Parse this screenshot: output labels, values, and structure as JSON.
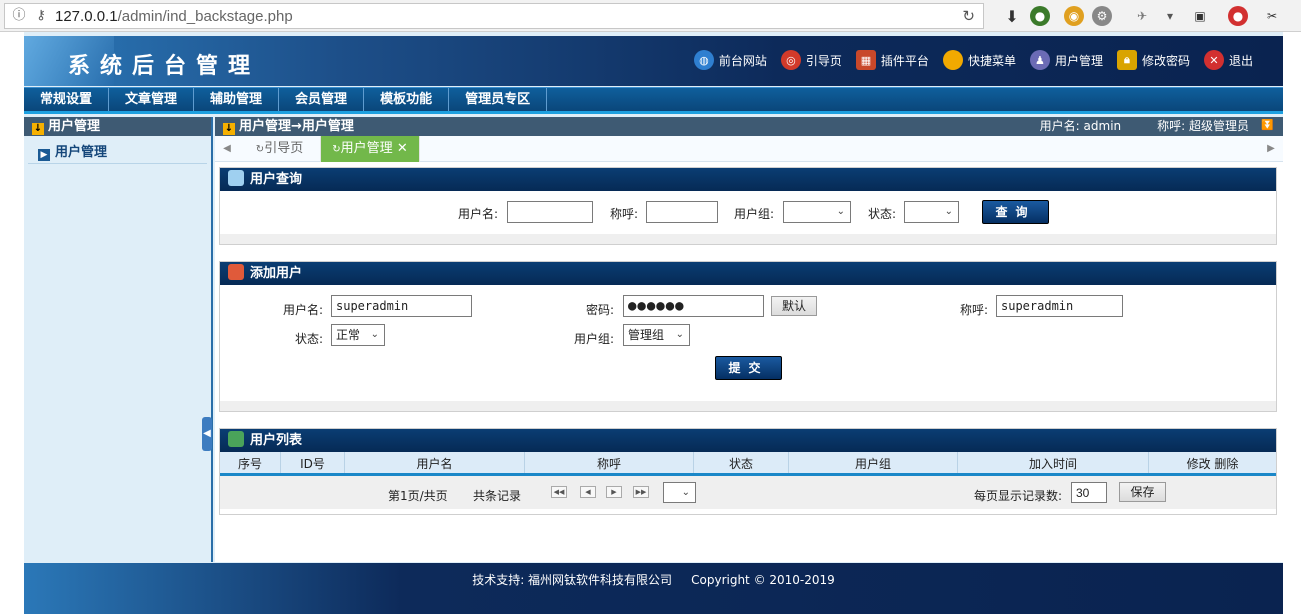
{
  "browser": {
    "url_host": "127.0.0.1",
    "url_path": "/admin/ind_backstage.php"
  },
  "app": {
    "title": "系统后台管理",
    "top_links": [
      {
        "label": "前台网站",
        "icon": "globe-icon",
        "color": "#2f7fd0"
      },
      {
        "label": "引导页",
        "icon": "lifebuoy-icon",
        "color": "#d23a2a"
      },
      {
        "label": "插件平台",
        "icon": "shop-icon",
        "color": "#c8482a"
      },
      {
        "label": "快捷菜单",
        "icon": "orb-icon",
        "color": "#f2a900"
      },
      {
        "label": "用户管理",
        "icon": "user-icon",
        "color": "#6b6bb5"
      },
      {
        "label": "修改密码",
        "icon": "lock-icon",
        "color": "#d9a400"
      },
      {
        "label": "退出",
        "icon": "close-icon",
        "color": "#d23030"
      }
    ],
    "nav": [
      "常规设置",
      "文章管理",
      "辅助管理",
      "会员管理",
      "模板功能",
      "管理员专区"
    ]
  },
  "sidebar": {
    "header": "用户管理",
    "items": [
      {
        "label": "用户管理"
      }
    ]
  },
  "content": {
    "breadcrumb": "用户管理→用户管理",
    "username_info": "用户名: admin",
    "title_info": "称呼: 超级管理员",
    "tabs": [
      {
        "label": "引导页",
        "active": false
      },
      {
        "label": "用户管理",
        "active": true
      }
    ]
  },
  "query_panel": {
    "title": "用户查询",
    "username_label": "用户名:",
    "nickname_label": "称呼:",
    "group_label": "用户组:",
    "status_label": "状态:",
    "submit_label": "查询"
  },
  "add_panel": {
    "title": "添加用户",
    "username_label": "用户名:",
    "username_value": "superadmin",
    "password_label": "密码:",
    "password_value": "●●●●●●",
    "default_label": "默认",
    "nickname_label": "称呼:",
    "nickname_value": "superadmin",
    "status_label": "状态:",
    "status_value": "正常",
    "group_label": "用户组:",
    "group_value": "管理组",
    "submit_label": "提交"
  },
  "list_panel": {
    "title": "用户列表",
    "columns": [
      "序号",
      "ID号",
      "用户名",
      "称呼",
      "状态",
      "用户组",
      "加入时间",
      "修改 删除"
    ],
    "pager_page": "第1页/共页",
    "pager_total": "共条记录",
    "per_page_label": "每页显示记录数:",
    "per_page_value": "30",
    "save_label": "保存"
  },
  "footer": {
    "support": "技术支持: 福州网钛软件科技有限公司",
    "copyright": "Copyright © 2010-2019"
  }
}
